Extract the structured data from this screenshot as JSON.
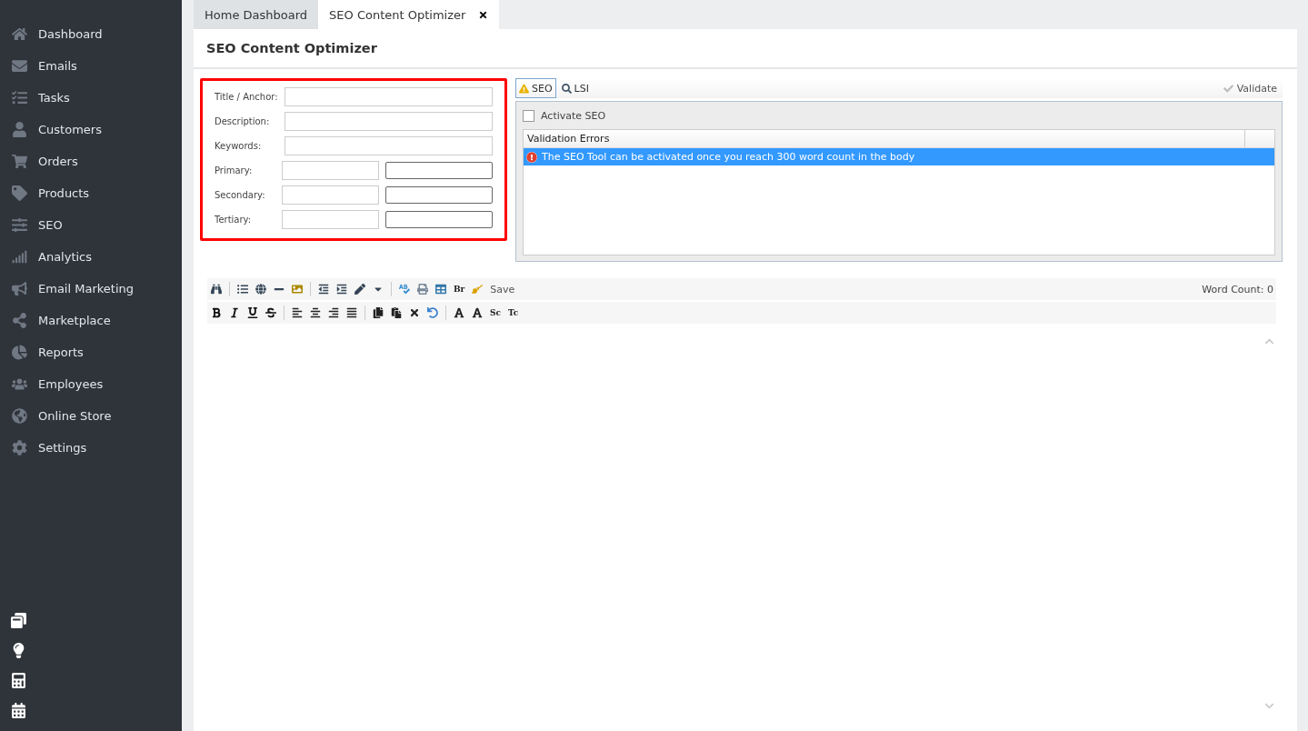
{
  "sidebar": {
    "items": [
      {
        "label": "Dashboard"
      },
      {
        "label": "Emails"
      },
      {
        "label": "Tasks"
      },
      {
        "label": "Customers"
      },
      {
        "label": "Orders"
      },
      {
        "label": "Products"
      },
      {
        "label": "SEO"
      },
      {
        "label": "Analytics"
      },
      {
        "label": "Email Marketing"
      },
      {
        "label": "Marketplace"
      },
      {
        "label": "Reports"
      },
      {
        "label": "Employees"
      },
      {
        "label": "Online Store"
      },
      {
        "label": "Settings"
      }
    ]
  },
  "tabs": [
    {
      "label": "Home Dashboard",
      "selected": false,
      "closable": false
    },
    {
      "label": "SEO Content Optimizer",
      "selected": true,
      "closable": true
    }
  ],
  "page_title": "SEO Content Optimizer",
  "form": {
    "fields": [
      {
        "label": "Title / Anchor:",
        "kind": "single"
      },
      {
        "label": "Description:",
        "kind": "single"
      },
      {
        "label": "Keywords:",
        "kind": "single"
      },
      {
        "label": "Primary:",
        "kind": "split"
      },
      {
        "label": "Secondary:",
        "kind": "split"
      },
      {
        "label": "Tertiary:",
        "kind": "split"
      }
    ]
  },
  "seo_panel": {
    "tabs": [
      {
        "label": "SEO",
        "selected": true
      },
      {
        "label": "LSI",
        "selected": false
      }
    ],
    "validate": "Validate",
    "activate": {
      "label": "Activate SEO",
      "checked": false
    },
    "grid": {
      "columns": [
        "Validation Errors"
      ],
      "rows": [
        {
          "text": "The SEO Tool can be activated once you reach 300 word count in the body",
          "selected": true
        }
      ]
    }
  },
  "editor": {
    "toolbar_labels": [
      "Br",
      "Sc",
      "Tc"
    ],
    "save": "Save",
    "word_count": "Word Count: 0"
  }
}
